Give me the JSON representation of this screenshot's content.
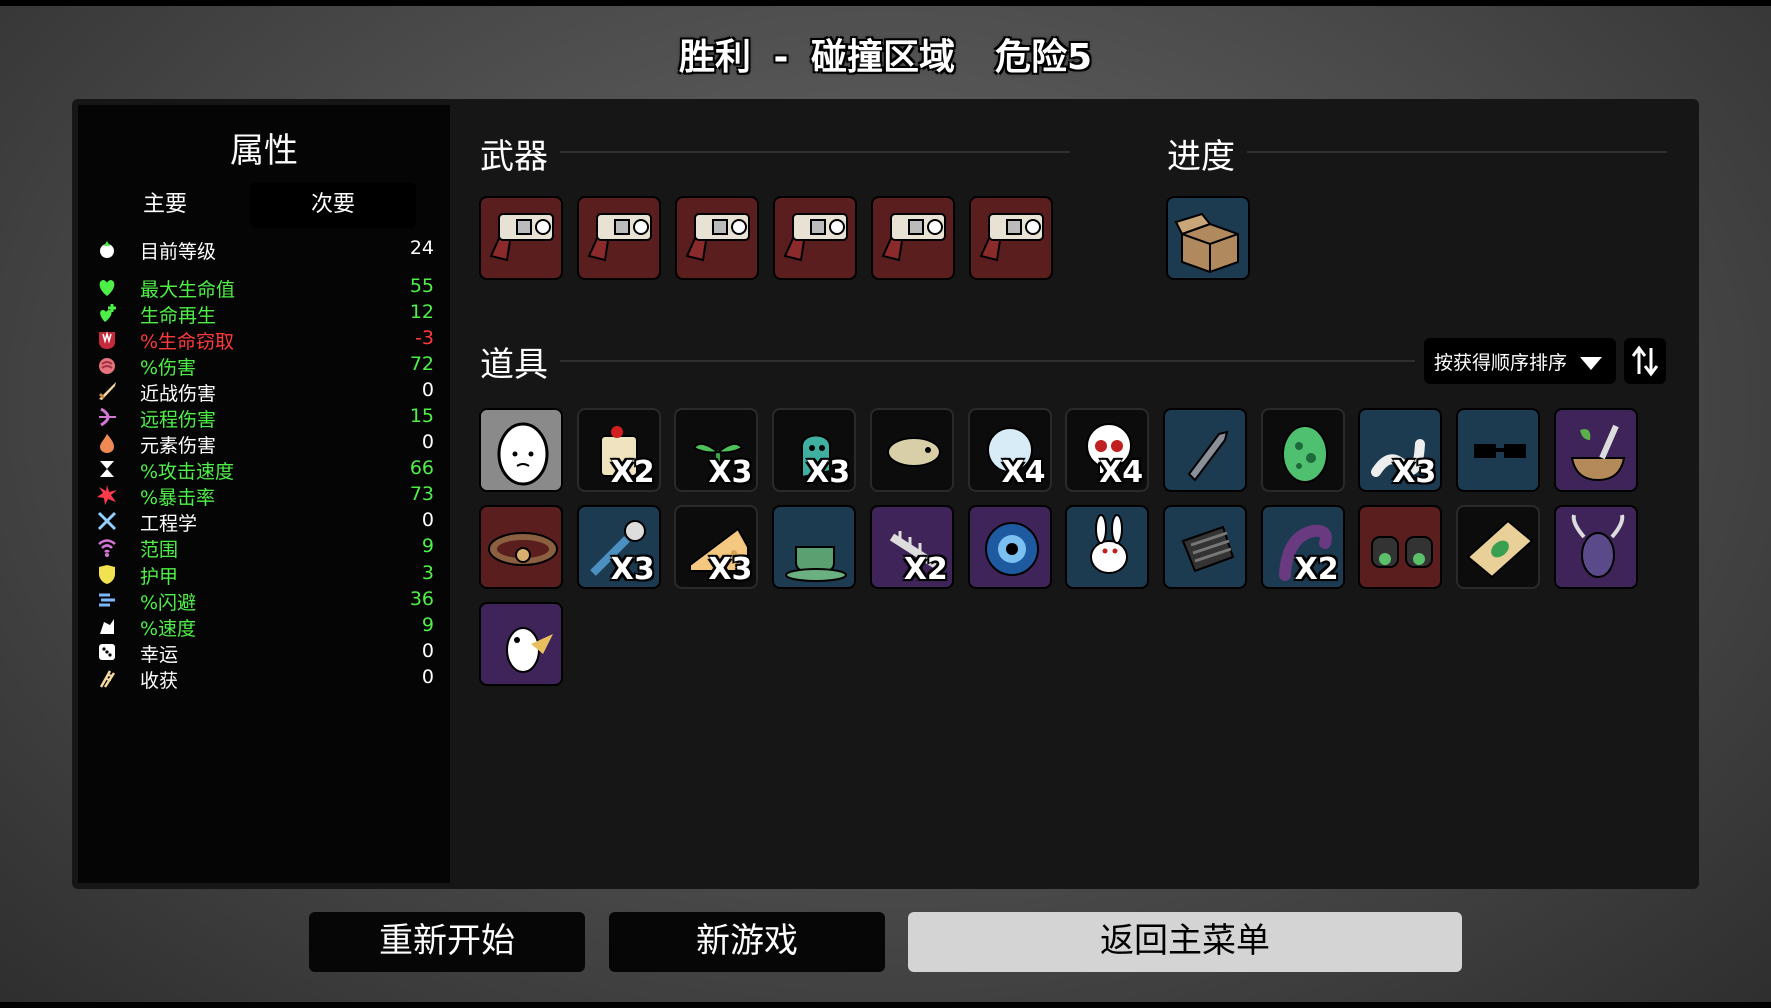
{
  "header": {
    "result": "胜利 - 碰撞区域",
    "danger": "危险5"
  },
  "stats": {
    "title": "属性",
    "tabs": [
      "主要",
      "次要"
    ],
    "rows": [
      {
        "name": "目前等级",
        "value": "24",
        "color": "white",
        "icon": "level-icon"
      },
      {
        "name": "最大生命值",
        "value": "55",
        "color": "green",
        "icon": "heart-icon"
      },
      {
        "name": "生命再生",
        "value": "12",
        "color": "green",
        "icon": "regen-icon"
      },
      {
        "name": "%生命窃取",
        "value": "-3",
        "color": "red",
        "icon": "lifesteal-icon"
      },
      {
        "name": "%伤害",
        "value": "72",
        "color": "green",
        "icon": "damage-icon"
      },
      {
        "name": "近战伤害",
        "value": "0",
        "color": "white",
        "icon": "melee-icon"
      },
      {
        "name": "远程伤害",
        "value": "15",
        "color": "green",
        "icon": "ranged-icon"
      },
      {
        "name": "元素伤害",
        "value": "0",
        "color": "white",
        "icon": "elemental-icon"
      },
      {
        "name": "%攻击速度",
        "value": "66",
        "color": "green",
        "icon": "attack-speed-icon"
      },
      {
        "name": "%暴击率",
        "value": "73",
        "color": "green",
        "icon": "crit-icon"
      },
      {
        "name": "工程学",
        "value": "0",
        "color": "white",
        "icon": "engineering-icon"
      },
      {
        "name": "范围",
        "value": "9",
        "color": "green",
        "icon": "range-icon"
      },
      {
        "name": "护甲",
        "value": "3",
        "color": "green",
        "icon": "armor-icon"
      },
      {
        "name": "%闪避",
        "value": "36",
        "color": "green",
        "icon": "dodge-icon"
      },
      {
        "name": "%速度",
        "value": "9",
        "color": "green",
        "icon": "speed-icon"
      },
      {
        "name": "幸运",
        "value": "0",
        "color": "white",
        "icon": "luck-icon"
      },
      {
        "name": "收获",
        "value": "0",
        "color": "white",
        "icon": "harvest-icon"
      }
    ]
  },
  "weapons": {
    "title": "武器",
    "items": [
      {
        "icon": "revolver-icon",
        "tier": "red"
      },
      {
        "icon": "revolver-icon",
        "tier": "red"
      },
      {
        "icon": "revolver-icon",
        "tier": "red"
      },
      {
        "icon": "revolver-icon",
        "tier": "red"
      },
      {
        "icon": "revolver-icon",
        "tier": "red"
      },
      {
        "icon": "revolver-icon",
        "tier": "red"
      }
    ]
  },
  "progress": {
    "title": "进度",
    "items": [
      {
        "icon": "box-icon",
        "tier": "blue"
      }
    ]
  },
  "items": {
    "title": "道具",
    "sort_label": "按获得顺序排序",
    "list": [
      {
        "icon": "egg-icon",
        "tier": "grey",
        "count": ""
      },
      {
        "icon": "scroll-icon",
        "tier": "black",
        "count": "X2"
      },
      {
        "icon": "sprout-icon",
        "tier": "black",
        "count": "X3"
      },
      {
        "icon": "ghost-icon",
        "tier": "black",
        "count": "X3"
      },
      {
        "icon": "fish-icon",
        "tier": "black",
        "count": ""
      },
      {
        "icon": "bubble-icon",
        "tier": "black",
        "count": "X4"
      },
      {
        "icon": "skull-icon",
        "tier": "black",
        "count": "X4"
      },
      {
        "icon": "bullet-icon",
        "tier": "blue",
        "count": ""
      },
      {
        "icon": "alien-egg-icon",
        "tier": "black",
        "count": ""
      },
      {
        "icon": "worm-icon",
        "tier": "blue",
        "count": "X3"
      },
      {
        "icon": "glasses-icon",
        "tier": "blue",
        "count": ""
      },
      {
        "icon": "mortar-icon",
        "tier": "purple",
        "count": ""
      },
      {
        "icon": "collar-icon",
        "tier": "red",
        "count": ""
      },
      {
        "icon": "flower-hand-icon",
        "tier": "blue",
        "count": "X3"
      },
      {
        "icon": "cheese-icon",
        "tier": "black",
        "count": "X3"
      },
      {
        "icon": "tea-cup-icon",
        "tier": "blue",
        "count": ""
      },
      {
        "icon": "fish-bone-icon",
        "tier": "purple",
        "count": "X2"
      },
      {
        "icon": "eye-icon",
        "tier": "purple",
        "count": ""
      },
      {
        "icon": "rabbit-icon",
        "tier": "blue",
        "count": ""
      },
      {
        "icon": "stripes-icon",
        "tier": "blue",
        "count": ""
      },
      {
        "icon": "tentacle-icon",
        "tier": "blue",
        "count": "X2"
      },
      {
        "icon": "binoculars-icon",
        "tier": "red",
        "count": ""
      },
      {
        "icon": "cash-icon",
        "tier": "black",
        "count": ""
      },
      {
        "icon": "bug-icon",
        "tier": "purple",
        "count": ""
      },
      {
        "icon": "voodoo-icon",
        "tier": "purple",
        "count": ""
      }
    ]
  },
  "buttons": {
    "restart": "重新开始",
    "new_game": "新游戏",
    "main_menu": "返回主菜单"
  },
  "colors": {
    "tier_red": "#5a1e1e",
    "tier_blue": "#1c3a50",
    "tier_purple": "#3e2458",
    "green": "#4ef048",
    "red": "#ff3a3a"
  }
}
